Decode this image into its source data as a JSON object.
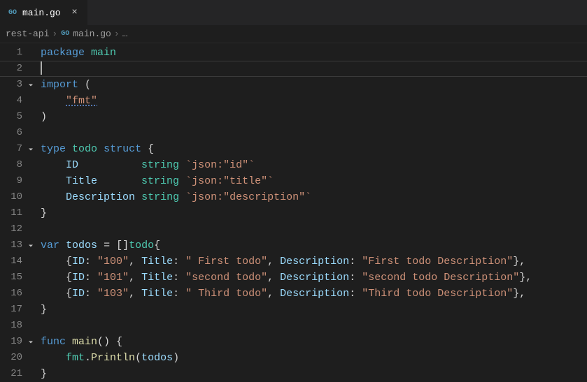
{
  "tab": {
    "iconText": "GO",
    "label": "main.go",
    "close": "×"
  },
  "breadcrumbs": {
    "root": "rest-api",
    "sep": "›",
    "fileIcon": "GO",
    "file": "main.go",
    "more": "…"
  },
  "activeLine": 2,
  "foldLines": [
    3,
    7,
    13,
    19
  ],
  "lines": [
    {
      "n": 1,
      "tokens": [
        [
          "kw",
          "package"
        ],
        [
          "pn",
          " "
        ],
        [
          "pkg",
          "main"
        ]
      ]
    },
    {
      "n": 2,
      "cursor": true,
      "tokens": []
    },
    {
      "n": 3,
      "tokens": [
        [
          "kw",
          "import"
        ],
        [
          "pn",
          " ("
        ]
      ]
    },
    {
      "n": 4,
      "tokens": [
        [
          "pn",
          "    "
        ],
        [
          "str squiggle",
          "\"fmt\""
        ]
      ]
    },
    {
      "n": 5,
      "tokens": [
        [
          "pn",
          ")"
        ]
      ]
    },
    {
      "n": 6,
      "tokens": []
    },
    {
      "n": 7,
      "tokens": [
        [
          "kw",
          "type"
        ],
        [
          "pn",
          " "
        ],
        [
          "typ",
          "todo"
        ],
        [
          "pn",
          " "
        ],
        [
          "kw",
          "struct"
        ],
        [
          "pn",
          " {"
        ]
      ]
    },
    {
      "n": 8,
      "tokens": [
        [
          "pn",
          "    "
        ],
        [
          "fld",
          "ID"
        ],
        [
          "pn",
          "          "
        ],
        [
          "typ",
          "string"
        ],
        [
          "pn",
          " "
        ],
        [
          "str",
          "`json:\"id\"`"
        ]
      ]
    },
    {
      "n": 9,
      "tokens": [
        [
          "pn",
          "    "
        ],
        [
          "fld",
          "Title"
        ],
        [
          "pn",
          "       "
        ],
        [
          "typ",
          "string"
        ],
        [
          "pn",
          " "
        ],
        [
          "str",
          "`json:\"title\"`"
        ]
      ]
    },
    {
      "n": 10,
      "tokens": [
        [
          "pn",
          "    "
        ],
        [
          "fld",
          "Description"
        ],
        [
          "pn",
          " "
        ],
        [
          "typ",
          "string"
        ],
        [
          "pn",
          " "
        ],
        [
          "str",
          "`json:\"description\"`"
        ]
      ]
    },
    {
      "n": 11,
      "tokens": [
        [
          "pn",
          "}"
        ]
      ]
    },
    {
      "n": 12,
      "tokens": []
    },
    {
      "n": 13,
      "tokens": [
        [
          "kw",
          "var"
        ],
        [
          "pn",
          " "
        ],
        [
          "fld",
          "todos"
        ],
        [
          "pn",
          " "
        ],
        [
          "op",
          "="
        ],
        [
          "pn",
          " []"
        ],
        [
          "typ",
          "todo"
        ],
        [
          "pn",
          "{"
        ]
      ]
    },
    {
      "n": 14,
      "tokens": [
        [
          "pn",
          "    {"
        ],
        [
          "fld",
          "ID"
        ],
        [
          "pn",
          ": "
        ],
        [
          "str",
          "\"100\""
        ],
        [
          "pn",
          ", "
        ],
        [
          "fld",
          "Title"
        ],
        [
          "pn",
          ": "
        ],
        [
          "str",
          "\" First todo\""
        ],
        [
          "pn",
          ", "
        ],
        [
          "fld",
          "Description"
        ],
        [
          "pn",
          ": "
        ],
        [
          "str",
          "\"First todo Description\""
        ],
        [
          "pn",
          "},"
        ]
      ]
    },
    {
      "n": 15,
      "tokens": [
        [
          "pn",
          "    {"
        ],
        [
          "fld",
          "ID"
        ],
        [
          "pn",
          ": "
        ],
        [
          "str",
          "\"101\""
        ],
        [
          "pn",
          ", "
        ],
        [
          "fld",
          "Title"
        ],
        [
          "pn",
          ": "
        ],
        [
          "str",
          "\"second todo\""
        ],
        [
          "pn",
          ", "
        ],
        [
          "fld",
          "Description"
        ],
        [
          "pn",
          ": "
        ],
        [
          "str",
          "\"second todo Description\""
        ],
        [
          "pn",
          "},"
        ]
      ]
    },
    {
      "n": 16,
      "tokens": [
        [
          "pn",
          "    {"
        ],
        [
          "fld",
          "ID"
        ],
        [
          "pn",
          ": "
        ],
        [
          "str",
          "\"103\""
        ],
        [
          "pn",
          ", "
        ],
        [
          "fld",
          "Title"
        ],
        [
          "pn",
          ": "
        ],
        [
          "str",
          "\" Third todo\""
        ],
        [
          "pn",
          ", "
        ],
        [
          "fld",
          "Description"
        ],
        [
          "pn",
          ": "
        ],
        [
          "str",
          "\"Third todo Description\""
        ],
        [
          "pn",
          "},"
        ]
      ]
    },
    {
      "n": 17,
      "tokens": [
        [
          "pn",
          "}"
        ]
      ]
    },
    {
      "n": 18,
      "tokens": []
    },
    {
      "n": 19,
      "tokens": [
        [
          "kw",
          "func"
        ],
        [
          "pn",
          " "
        ],
        [
          "fn",
          "main"
        ],
        [
          "pn",
          "() {"
        ]
      ]
    },
    {
      "n": 20,
      "tokens": [
        [
          "pn",
          "    "
        ],
        [
          "mod",
          "fmt"
        ],
        [
          "pn",
          "."
        ],
        [
          "fn",
          "Println"
        ],
        [
          "pn",
          "("
        ],
        [
          "fld",
          "todos"
        ],
        [
          "pn",
          ")"
        ]
      ]
    },
    {
      "n": 21,
      "tokens": [
        [
          "pn",
          "}"
        ]
      ]
    }
  ]
}
